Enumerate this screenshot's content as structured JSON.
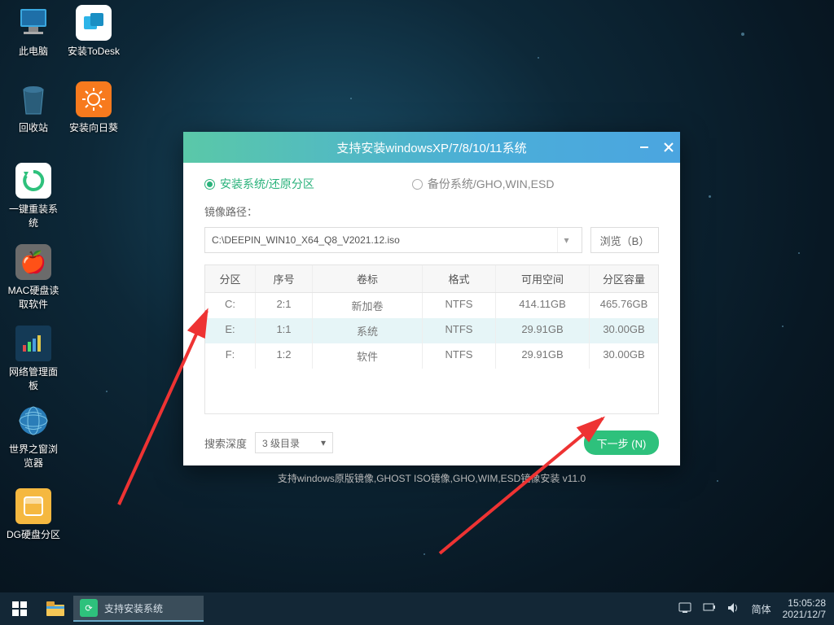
{
  "desktop_icons": [
    {
      "label": "此电脑",
      "ic": "pc"
    },
    {
      "label": "安装ToDesk",
      "ic": "todesk"
    },
    {
      "label": "回收站",
      "ic": "bin"
    },
    {
      "label": "安装向日葵",
      "ic": "sun"
    },
    {
      "label": "一键重装系统",
      "ic": "reinstall"
    },
    {
      "label": "MAC硬盘读取软件",
      "ic": "mac"
    },
    {
      "label": "网络管理面板",
      "ic": "net"
    },
    {
      "label": "世界之窗浏览器",
      "ic": "globe"
    },
    {
      "label": "DG硬盘分区",
      "ic": "dg"
    }
  ],
  "dialog": {
    "title": "支持安装windowsXP/7/8/10/11系统",
    "radio_install": "安装系统/还原分区",
    "radio_backup": "备份系统/GHO,WIN,ESD",
    "path_label": "镜像路径：",
    "path_value": "C:\\DEEPIN_WIN10_X64_Q8_V2021.12.iso",
    "browse": "浏览（B）",
    "headers": {
      "c1": "分区",
      "c2": "序号",
      "c3": "卷标",
      "c4": "格式",
      "c5": "可用空间",
      "c6": "分区容量"
    },
    "rows": [
      {
        "p": "C:",
        "n": "2:1",
        "vol": "新加卷",
        "fmt": "NTFS",
        "free": "414.11GB",
        "cap": "465.76GB",
        "sel": false
      },
      {
        "p": "E:",
        "n": "1:1",
        "vol": "系统",
        "fmt": "NTFS",
        "free": "29.91GB",
        "cap": "30.00GB",
        "sel": true
      },
      {
        "p": "F:",
        "n": "1:2",
        "vol": "软件",
        "fmt": "NTFS",
        "free": "29.91GB",
        "cap": "30.00GB",
        "sel": false
      }
    ],
    "search_depth_label": "搜索深度",
    "search_depth_value": "3 级目录",
    "next": "下一步 (N)",
    "hint": "支持windows原版镜像,GHOST ISO镜像,GHO,WIM,ESD镜像安装 v11.0"
  },
  "taskbar": {
    "task_label": "支持安装系统",
    "ime": "简体",
    "time": "15:05:28",
    "date": "2021/12/7"
  }
}
